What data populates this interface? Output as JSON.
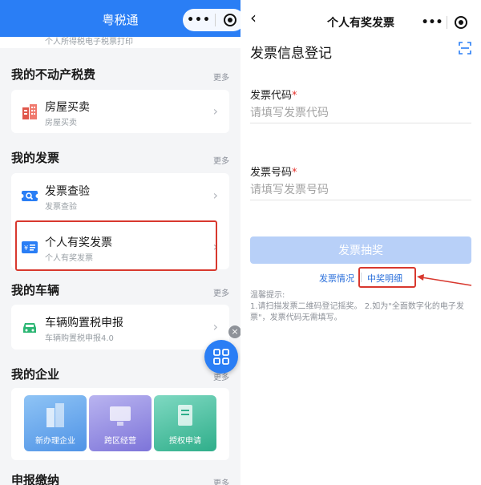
{
  "left": {
    "header": {
      "title": "粤税通"
    },
    "strip_text": "个人所得税电子税票打印",
    "sections": {
      "real_estate": {
        "title": "我的不动产税费",
        "more": "更多"
      },
      "invoice": {
        "title": "我的发票",
        "more": "更多"
      },
      "vehicle": {
        "title": "我的车辆",
        "more": "更多"
      },
      "enterprise": {
        "title": "我的企业",
        "more": "更多"
      },
      "declare": {
        "title": "申报缴纳",
        "more": "更多"
      }
    },
    "cards": {
      "house": {
        "title": "房屋买卖",
        "subtitle": "房屋买卖"
      },
      "invoice_check": {
        "title": "发票查验",
        "subtitle": "发票查验"
      },
      "personal_invoice": {
        "title": "个人有奖发票",
        "subtitle": "个人有奖发票"
      },
      "vehicle_tax": {
        "title": "车辆购置税申报",
        "subtitle": "车辆购置税申报4.0"
      }
    },
    "biz_tiles": [
      "新办理企业",
      "跨区经营",
      "授权申请"
    ],
    "float_close": "×"
  },
  "right": {
    "header": {
      "back": "‹",
      "title": "个人有奖发票"
    },
    "heading": "发票信息登记",
    "fields": {
      "code": {
        "label": "发票代码",
        "required": "*",
        "placeholder": "请填写发票代码"
      },
      "number": {
        "label": "发票号码",
        "required": "*",
        "placeholder": "请填写发票号码"
      }
    },
    "submit": "发票抽奖",
    "links": {
      "status": "发票情况",
      "detail": "中奖明细"
    },
    "tips": {
      "title": "温馨提示:",
      "body": "1.请扫描发票二维码登记摇奖。 2.如为\"全面数字化的电子发票\"，发票代码无需填写。"
    }
  },
  "capsule": {
    "more": "•••"
  },
  "colors": {
    "brand": "#2a7ef5",
    "highlight": "#d8382e",
    "button_disabled": "#b8d0f8",
    "link": "#2a6fdb"
  }
}
